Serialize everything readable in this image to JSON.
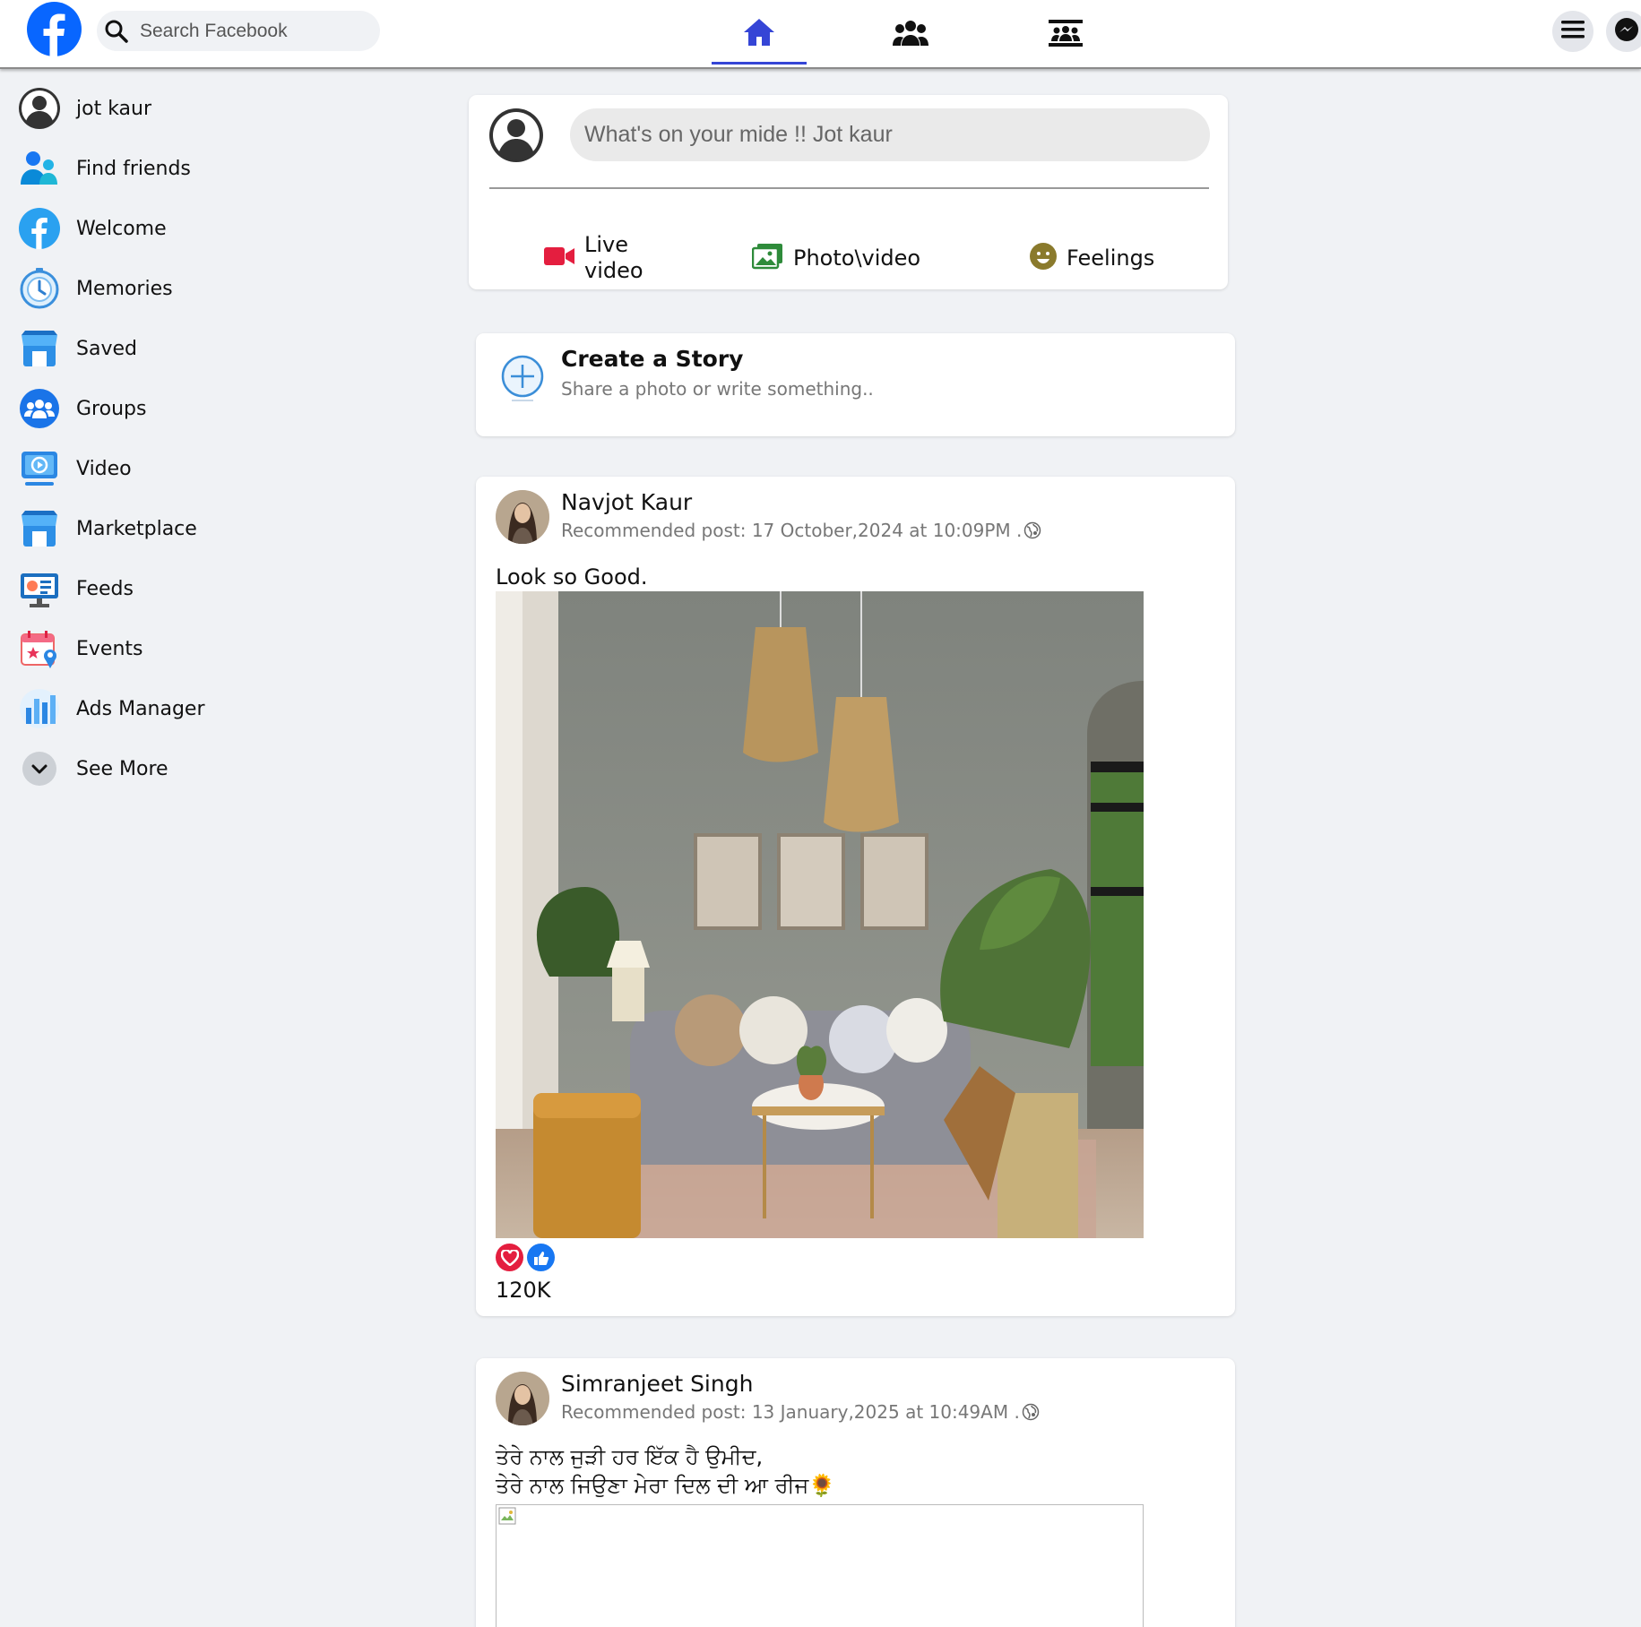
{
  "topbar": {
    "search_placeholder": "Search Facebook",
    "brand_color": "#0866ff",
    "active_tab_color": "#3545d6",
    "tabs": [
      {
        "icon": "home-icon",
        "active": true
      },
      {
        "icon": "friends-icon",
        "active": false
      },
      {
        "icon": "groups-icon",
        "active": false
      }
    ],
    "right_buttons": [
      "menu-icon",
      "messenger-icon"
    ]
  },
  "sidebar": {
    "items": [
      {
        "label": "jot kaur",
        "icon": "profile-avatar-icon"
      },
      {
        "label": "Find friends",
        "icon": "find-friends-icon"
      },
      {
        "label": "Welcome",
        "icon": "facebook-logo-icon"
      },
      {
        "label": "Memories",
        "icon": "memories-clock-icon"
      },
      {
        "label": "Saved",
        "icon": "saved-store-icon"
      },
      {
        "label": "Groups",
        "icon": "groups-icon"
      },
      {
        "label": "Video",
        "icon": "video-icon"
      },
      {
        "label": "Marketplace",
        "icon": "marketplace-store-icon"
      },
      {
        "label": "Feeds",
        "icon": "feeds-icon"
      },
      {
        "label": "Events",
        "icon": "events-calendar-icon"
      },
      {
        "label": "Ads Manager",
        "icon": "ads-manager-chart-icon"
      },
      {
        "label": "See More",
        "icon": "chevron-down-icon"
      }
    ]
  },
  "composer": {
    "placeholder": "What's on your mide !! Jot kaur",
    "actions": [
      {
        "label": "Live\nvideo",
        "icon": "live-video-icon",
        "color": "#e41e3f"
      },
      {
        "label": "Photo\\video",
        "icon": "photo-icon",
        "color": "#45bd62"
      },
      {
        "label": "Feelings",
        "icon": "feeling-smile-icon",
        "color": "#a08a35"
      }
    ]
  },
  "story": {
    "title": "Create a Story",
    "subtitle": "Share a photo or write something.."
  },
  "posts": [
    {
      "author": "Navjot Kaur",
      "meta": "Recommended post: 17 October,2024 at 10:09PM .",
      "text": "Look so Good.",
      "reactions": [
        "love-react-icon",
        "like-react-icon"
      ],
      "reaction_count": "120K"
    },
    {
      "author": "Simranjeet Singh",
      "meta": "Recommended post: 13 January,2025 at 10:49AM .",
      "text_line1": "ਤੇਰੇ ਨਾਲ ਜੁੜੀ ਹਰ ਇੱਕ ਹੈ ਉਮੀਦ,",
      "text_line2": "ਤੇਰੇ ਨਾਲ ਜਿਉਣਾ ਮੇਰਾ ਦਿਲ ਦੀ ਆ ਰੀਜ🌻"
    }
  ]
}
